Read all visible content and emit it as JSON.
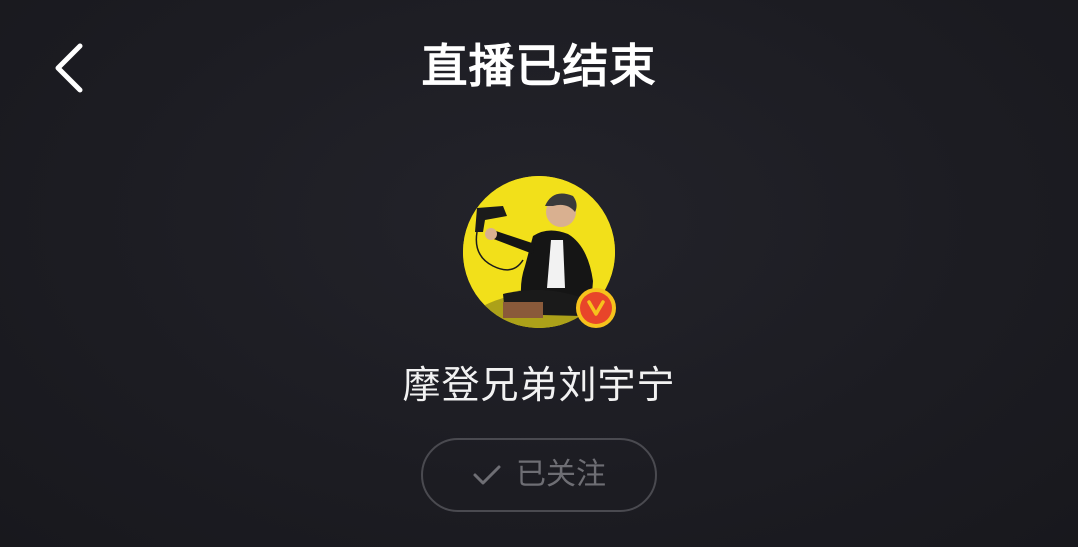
{
  "header": {
    "title": "直播已结束",
    "back_icon": "chevron-left-icon"
  },
  "streamer": {
    "name": "摩登兄弟刘宇宁",
    "verified": true,
    "verified_badge_text": "V"
  },
  "follow": {
    "label": "已关注",
    "icon": "check-icon",
    "state": "followed"
  },
  "colors": {
    "background": "#1d1d23",
    "title_text": "#ffffff",
    "follow_text": "#6e6e74",
    "avatar_bg": "#f2e01a",
    "badge_gold": "#f6c21c",
    "badge_red": "#e8452a"
  }
}
